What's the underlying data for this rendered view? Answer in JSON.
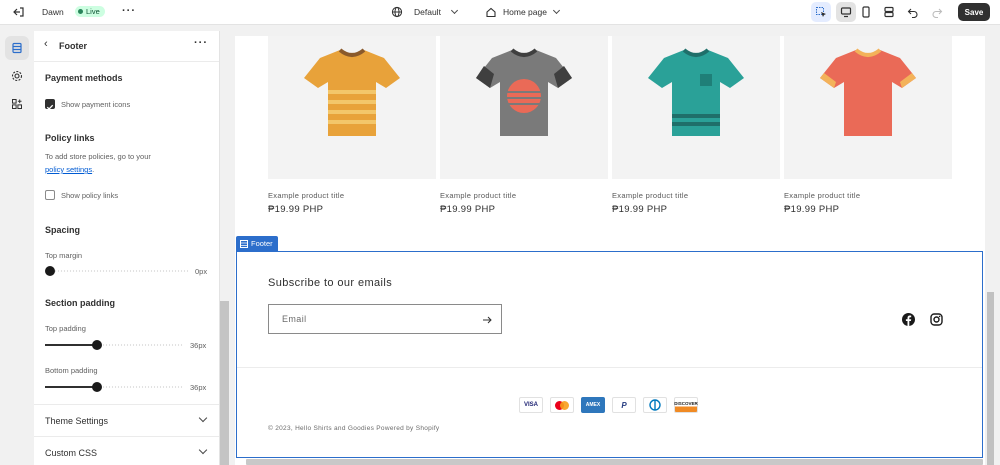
{
  "topbar": {
    "theme_name": "Dawn",
    "live_label": "Live",
    "template_label": "Default",
    "page_label": "Home page",
    "save_label": "Save"
  },
  "sidebar": {
    "title": "Footer",
    "payment": {
      "heading": "Payment methods",
      "checkbox_label": "Show payment icons",
      "checked": true
    },
    "policy": {
      "heading": "Policy links",
      "help_text": "To add store policies, go to your",
      "help_link": "policy settings",
      "help_end": ".",
      "checkbox_label": "Show policy links",
      "checked": false
    },
    "spacing": {
      "heading": "Spacing",
      "top_margin_label": "Top margin",
      "top_margin_value": "0px",
      "top_margin_level": 0
    },
    "section_padding": {
      "heading": "Section padding",
      "top_label": "Top padding",
      "top_value": "36px",
      "top_level": 0.36,
      "bottom_label": "Bottom padding",
      "bottom_value": "36px",
      "bottom_level": 0.36
    },
    "collapsibles": [
      {
        "label": "Theme Settings"
      },
      {
        "label": "Custom CSS"
      }
    ]
  },
  "preview": {
    "products": [
      {
        "title": "Example product title",
        "price": "₱19.99 PHP",
        "color": "#e8a23a"
      },
      {
        "title": "Example product title",
        "price": "₱19.99 PHP",
        "color": "#7a7a7a"
      },
      {
        "title": "Example product title",
        "price": "₱19.99 PHP",
        "color": "#2aa198"
      },
      {
        "title": "Example product title",
        "price": "₱19.99 PHP",
        "color": "#ea6a57"
      }
    ],
    "footer_tag": "Footer",
    "subscribe_heading": "Subscribe to our emails",
    "email_placeholder": "Email",
    "payment_icons": [
      {
        "label": "VISA",
        "icon": "visa-icon"
      },
      {
        "label": "",
        "icon": "mastercard-icon"
      },
      {
        "label": "AMEX",
        "icon": "amex-icon"
      },
      {
        "label": "P",
        "icon": "paypal-icon"
      },
      {
        "label": "",
        "icon": "diners-club-icon"
      },
      {
        "label": "DISCOVER",
        "icon": "discover-icon"
      }
    ],
    "copyright": "© 2023, Hello Shirts and Goodies Powered by Shopify"
  },
  "colors": {
    "accent": "#2c6ecb",
    "save_bg": "#303030",
    "live_bg": "#cdfee1"
  }
}
